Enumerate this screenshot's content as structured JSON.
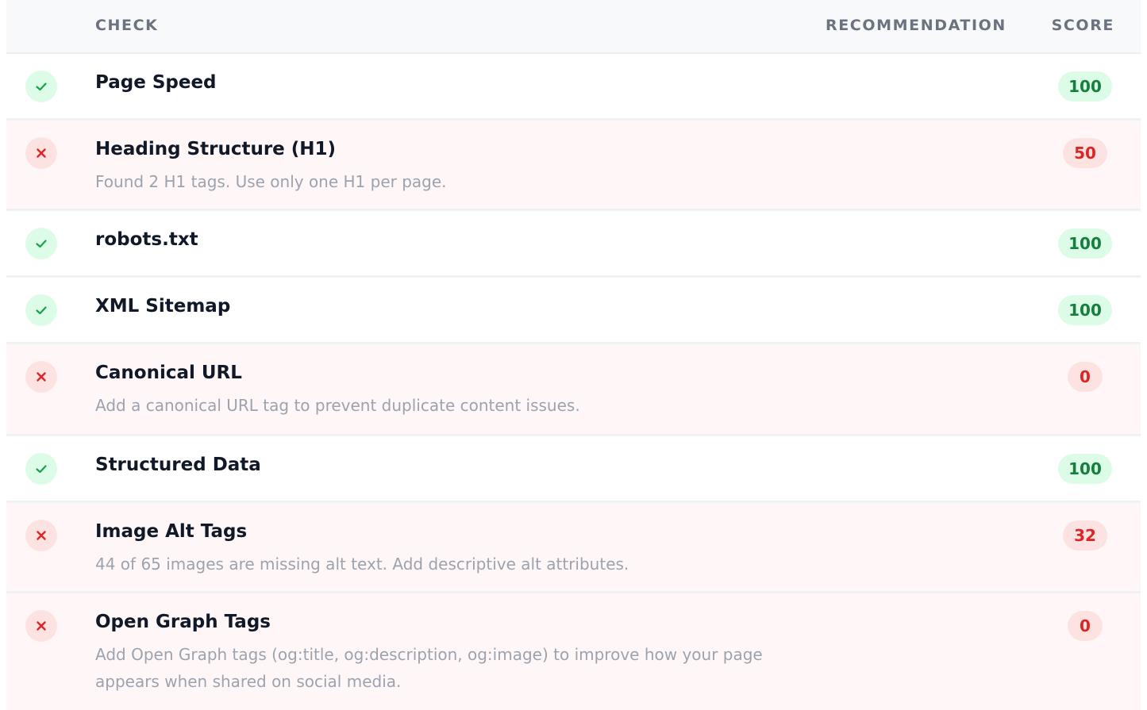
{
  "header": {
    "check": "CHECK",
    "recommendation": "RECOMMENDATION",
    "score": "SCORE"
  },
  "colors": {
    "pass_accent": "#16a34a",
    "pass_bg": "#dcfce7",
    "fail_accent": "#dc2626",
    "fail_bg": "#fde2e2"
  },
  "rows": [
    {
      "status": "pass",
      "icon": "check-icon",
      "title": "Page Speed",
      "description": "",
      "score": "100"
    },
    {
      "status": "fail",
      "icon": "cross-icon",
      "title": "Heading Structure (H1)",
      "description": "Found 2 H1 tags. Use only one H1 per page.",
      "score": "50"
    },
    {
      "status": "pass",
      "icon": "check-icon",
      "title": "robots.txt",
      "description": "",
      "score": "100"
    },
    {
      "status": "pass",
      "icon": "check-icon",
      "title": "XML Sitemap",
      "description": "",
      "score": "100"
    },
    {
      "status": "fail",
      "icon": "cross-icon",
      "title": "Canonical URL",
      "description": "Add a canonical URL tag to prevent duplicate content issues.",
      "score": "0"
    },
    {
      "status": "pass",
      "icon": "check-icon",
      "title": "Structured Data",
      "description": "",
      "score": "100"
    },
    {
      "status": "fail",
      "icon": "cross-icon",
      "title": "Image Alt Tags",
      "description": "44 of 65 images are missing alt text. Add descriptive alt attributes.",
      "score": "32"
    },
    {
      "status": "fail",
      "icon": "cross-icon",
      "title": "Open Graph Tags",
      "description": "Add Open Graph tags (og:title, og:description, og:image) to improve how your page appears when shared on social media.",
      "score": "0"
    }
  ]
}
